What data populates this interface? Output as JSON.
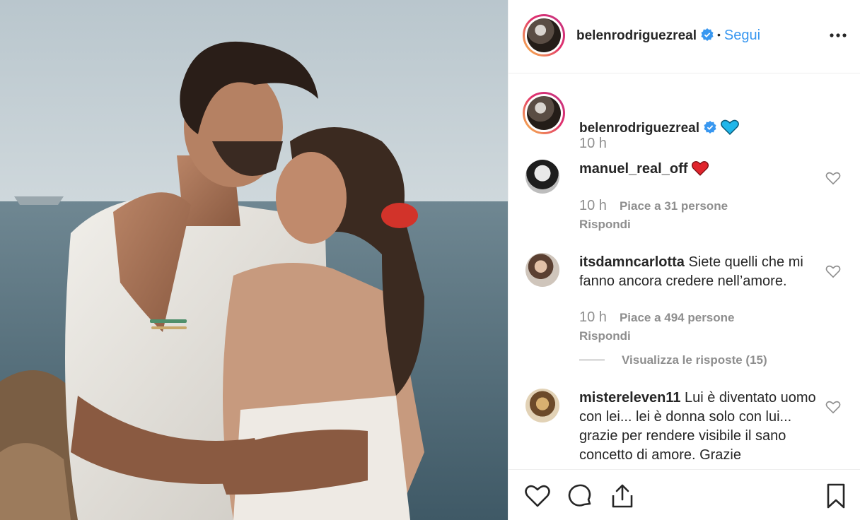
{
  "post": {
    "photo_alt": "Foto del post",
    "author": "belenrodriguezreal",
    "follow_label": "Segui",
    "separator": "•",
    "caption_time": "10 h"
  },
  "comments": [
    {
      "username": "manuel_real_off",
      "text": "",
      "emoji": "red-heart",
      "time": "10 h",
      "likes": "Piace a 31 persone",
      "reply": "Rispondi"
    },
    {
      "username": "itsdamncarlotta",
      "text": "Siete quelli che mi fanno ancora credere nell’amore.",
      "time": "10 h",
      "likes": "Piace a 494 persone",
      "reply": "Rispondi",
      "view_replies": "Visualizza le risposte (15)"
    },
    {
      "username": "mistereleven11",
      "text": "Lui è diventato uomo con lei... lei è donna solo con lui... grazie per rendere visibile il sano concetto di amore. Grazie"
    }
  ],
  "icons": {
    "verified": "verified-badge-icon",
    "blue_heart": "blue-heart-emoji",
    "red_heart": "red-heart-emoji",
    "more": "more-options-icon",
    "like": "heart-icon",
    "comment": "comment-icon",
    "share": "share-icon",
    "save": "bookmark-icon"
  },
  "colors": {
    "link_blue": "#3897f0",
    "muted_text": "#8e8e8e",
    "verified_blue": "#3897f0",
    "divider": "#efefef"
  }
}
